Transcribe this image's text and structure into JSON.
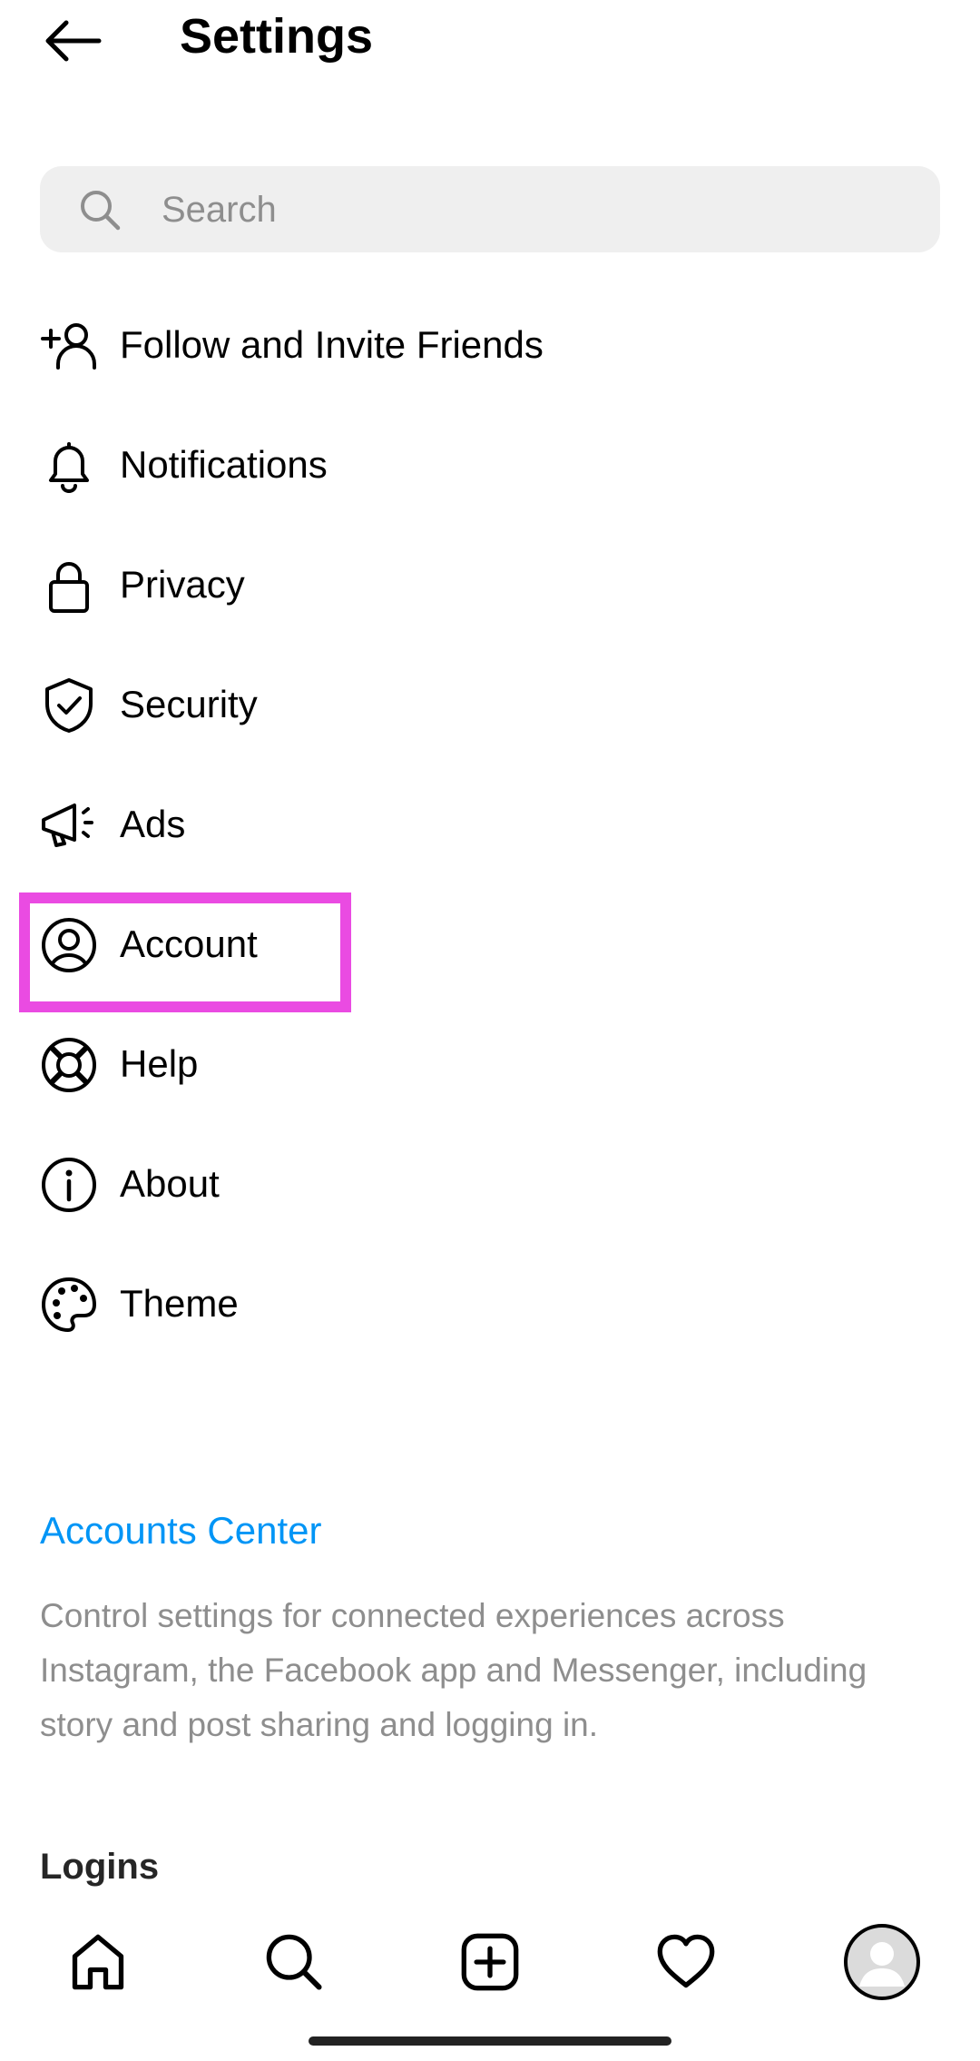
{
  "header": {
    "title": "Settings"
  },
  "search": {
    "placeholder": "Search"
  },
  "menu": [
    {
      "label": "Follow and Invite Friends",
      "icon": "add-person-icon"
    },
    {
      "label": "Notifications",
      "icon": "bell-icon"
    },
    {
      "label": "Privacy",
      "icon": "lock-icon"
    },
    {
      "label": "Security",
      "icon": "shield-check-icon"
    },
    {
      "label": "Ads",
      "icon": "megaphone-icon"
    },
    {
      "label": "Account",
      "icon": "account-circle-icon"
    },
    {
      "label": "Help",
      "icon": "lifebuoy-icon"
    },
    {
      "label": "About",
      "icon": "info-icon"
    },
    {
      "label": "Theme",
      "icon": "palette-icon"
    }
  ],
  "accounts_center": {
    "title": "Accounts Center",
    "description": "Control settings for connected experiences across Instagram, the Facebook app and Messenger, including story and post sharing and logging in."
  },
  "logins": {
    "title": "Logins"
  },
  "bottom_nav": [
    "home-icon",
    "search-icon",
    "create-post-icon",
    "heart-icon",
    "profile-avatar"
  ],
  "colors": {
    "accent": "#0095f6",
    "highlight": "#ea4be2",
    "search_bg": "#efefef",
    "muted_text": "#8e8e8e"
  }
}
